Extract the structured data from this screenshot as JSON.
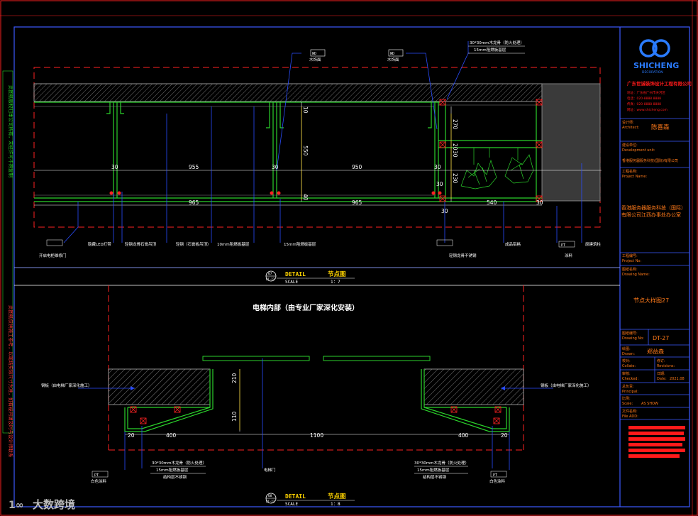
{
  "colors": {
    "frame": "#3d5bff",
    "hatch": "#aaaaaa",
    "green": "#2bd12b",
    "dim": "#ffffff",
    "dim_yellow": "#ffd400",
    "red": "#ff2222",
    "leader": "#2a4dff",
    "title_red": "#ff1a1a",
    "orange": "#ff7a1a",
    "grey_block": "#3a3a3a"
  },
  "upper": {
    "tags_top": [
      {
        "code": "WD",
        "label": "木饰面"
      },
      {
        "code": "WD",
        "label": "木饰面"
      }
    ],
    "notes_top_right": [
      "30*30mm木龙骨（防火处理）",
      "15mm阻燃板基层"
    ],
    "dims_30": [
      "30",
      "30",
      "30",
      "30",
      "30",
      "30",
      "30"
    ],
    "dims": {
      "d955": "955",
      "d950": "950",
      "d965a": "965",
      "d965b": "965",
      "d540": "540",
      "d10": "10",
      "d550": "550",
      "d40": "40",
      "d270": "270",
      "d20": "20",
      "d230": "230"
    },
    "callouts_bottom": [
      {
        "code": "",
        "label": "开启电柜维修门"
      },
      {
        "code": "",
        "label": "隐藏LED灯带"
      },
      {
        "code": "",
        "label": "轻钢龙骨石膏吊顶"
      },
      {
        "code": "",
        "label": "轻钢（石膏板吊顶）"
      },
      {
        "code": "",
        "label": "10mm阻燃板基层"
      },
      {
        "code": "",
        "label": "15mm阻燃板基层"
      },
      {
        "code": "",
        "label": "轻钢龙骨不锈钢"
      },
      {
        "code": "",
        "label": "成品铝格"
      },
      {
        "code": "PT",
        "label": "涂料"
      },
      {
        "code": "",
        "label": "原建筑柱"
      }
    ],
    "title": {
      "num": "07",
      "sheet": "DT-27",
      "detail": "DETAIL",
      "name": "节点图",
      "scale_label": "SCALE",
      "scale": "1：7"
    }
  },
  "lower": {
    "heading": "电梯内部（由专业厂家深化安装）",
    "left_note": "钢板（由电梯厂家深化施工）",
    "right_note": "钢板（由电梯厂家深化施工）",
    "dims": {
      "d210": "210",
      "d110": "110",
      "d20a": "20",
      "d400a": "400",
      "d1100": "1100",
      "d400b": "400",
      "d20b": "20"
    },
    "left_notes": [
      "30*30mm木龙骨（防火处理）",
      "15mm阻燃板基层",
      "结构层不锈钢"
    ],
    "right_notes": [
      "30*30mm木龙骨（防火处理）",
      "15mm阻燃板基层",
      "结构层不锈钢"
    ],
    "center_callout": "电梯门",
    "left_tag": {
      "code": "PT",
      "label": "白色涂料"
    },
    "right_tag": {
      "code": "PT",
      "label": "白色涂料"
    },
    "title": {
      "num": "08",
      "sheet": "DT-27",
      "detail": "DETAIL",
      "name": "节点图",
      "scale_label": "SCALE",
      "scale": "1：8"
    }
  },
  "left_margin": {
    "top": "此图纸版权归本公司所有，未经许可不得复制",
    "bottom": "此图纸仅供施工参考，以现场实际尺寸为准，如有疑问请及时与设计师联系"
  },
  "title_block": {
    "logo_text": "SHICHENG",
    "logo_sub": "DECORATION",
    "company_red": "广东世诚装饰设计工程有限公司",
    "red_lines": [
      "地址：广东省广州市天河区",
      "电话：020-8888 8888",
      "传真：020-8888 8888",
      "网址：www.shicheng.com"
    ],
    "designer_label": "设计师:",
    "designer_label_en": "Architect:",
    "designer": "陈喜森",
    "dept_label": "建设单位:",
    "dept_label_en": "Development unit:",
    "dept": "香港服务器服务科技(国际)有限公司",
    "project_label": "工程名称:",
    "project_label_en": "Project Name:",
    "project": "香港服务器服务科技（国际）有限公司江西办事处办公室",
    "proj_no_label": "工程编号:",
    "proj_no_label_en": "Project No:",
    "drawing_label": "图纸名称:",
    "drawing_label_en": "Drawing Name:",
    "drawing": "节点大样图27",
    "drawing_no_label": "图纸编号:",
    "drawing_no_label_en": "Drawing No:",
    "drawing_no": "DT-27",
    "draw_label": "绘图:",
    "draw_label_en": "Drawn:",
    "draw": "郑益森",
    "collate_label": "校对:",
    "collate_label_en": "Collate:",
    "revision_label": "修订:",
    "revision_label_en": "Revisions:",
    "check_label": "审核:",
    "check_label_en": "Checked:",
    "date_label": "日期:",
    "date_label_en": "Date:",
    "date": "2021.08",
    "principal_label": "总负责:",
    "principal_label_en": "Principal:",
    "scale_label": "比例:",
    "scale_label_en": "Scale:",
    "scale": "AS SHOW",
    "file_label": "文件名称:",
    "file_label_en": "File ADD:"
  },
  "watermark": "大数跨境"
}
